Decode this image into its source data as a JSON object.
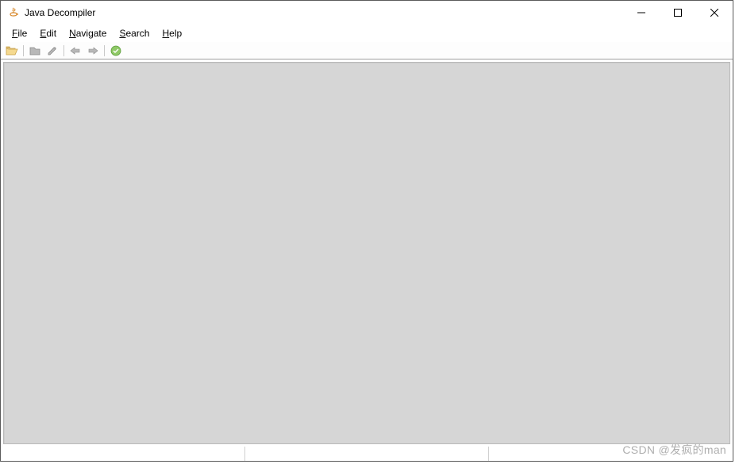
{
  "window": {
    "title": "Java Decompiler"
  },
  "menu": {
    "file": "File",
    "edit": "Edit",
    "navigate": "Navigate",
    "search": "Search",
    "help": "Help"
  },
  "toolbar": {
    "open": "open-file-icon",
    "open_type": "open-type-icon",
    "save": "save-icon",
    "back": "back-icon",
    "forward": "forward-icon",
    "refresh": "refresh-icon"
  },
  "watermark": "CSDN @发疯的man"
}
